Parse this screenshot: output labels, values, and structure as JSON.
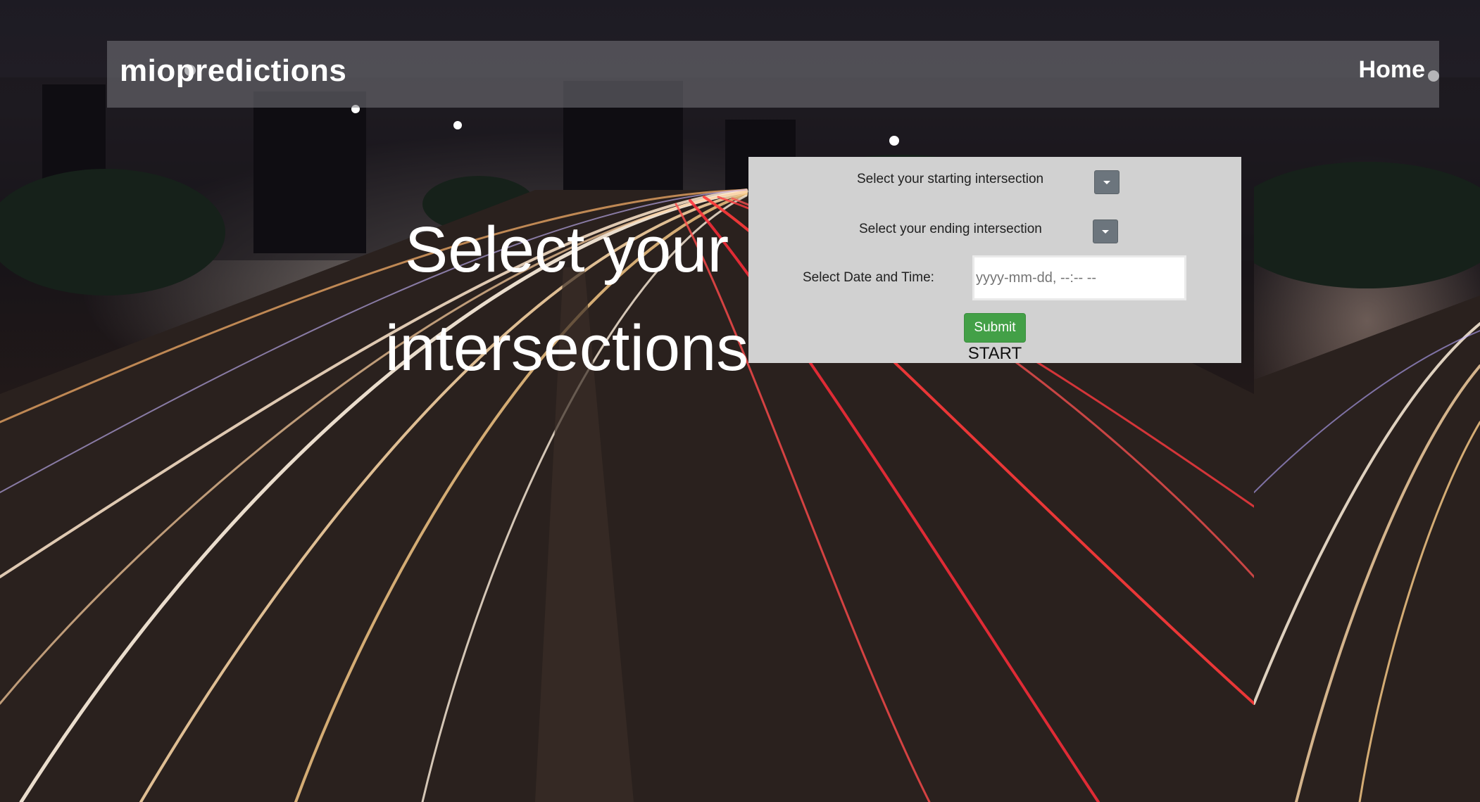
{
  "navbar": {
    "brand": "miopredictions",
    "home_link": "Home"
  },
  "hero": {
    "line1": "Select your",
    "line2": "intersections"
  },
  "form": {
    "start_label": "Select your starting intersection",
    "end_label": "Select your ending intersection",
    "datetime_label": "Select Date and Time:",
    "datetime_placeholder": "yyyy-mm-dd, --:-- --",
    "submit_label": "Submit",
    "start_text": "START"
  },
  "icons": {
    "dropdown": "chevron-down-icon"
  },
  "colors": {
    "panel_bg": "#d1d1d1",
    "submit_bg": "#43a047",
    "dropdown_bg": "#6c757d"
  }
}
